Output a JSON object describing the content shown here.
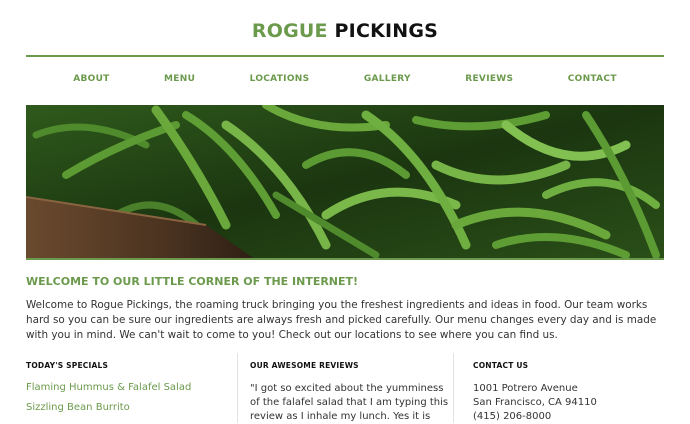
{
  "brand": {
    "first": "ROGUE",
    "second": "PICKINGS"
  },
  "nav": [
    "ABOUT",
    "MENU",
    "LOCATIONS",
    "GALLERY",
    "REVIEWS",
    "CONTACT"
  ],
  "hero": {
    "image": "green-beans-photo"
  },
  "welcome": {
    "title": "WELCOME TO OUR LITTLE CORNER OF THE INTERNET!",
    "text": "Welcome to Rogue Pickings, the roaming truck bringing you the freshest ingredients and ideas in food. Our team works hard so you can be sure our ingredients are always fresh and picked carefully. Our menu changes every day and is made with you in mind. We can't wait to come to you! Check out our locations to see where you can find us."
  },
  "specials": {
    "title": "TODAY'S SPECIALS",
    "items": [
      "Flaming Hummus & Falafel Salad",
      "Sizzling Bean Burrito"
    ]
  },
  "reviews": {
    "title": "OUR AWESOME REVIEWS",
    "text": "\"I got so excited about the yumminess of the falafel salad that I am typing this review as I inhale my lunch. Yes it is"
  },
  "contact": {
    "title": "CONTACT US",
    "street": "1001 Potrero Avenue",
    "city": "San Francisco, CA 94110",
    "phone": "(415) 206-8000"
  },
  "colors": {
    "accent": "#6b9a4c",
    "text": "#333333",
    "dark": "#111111"
  }
}
